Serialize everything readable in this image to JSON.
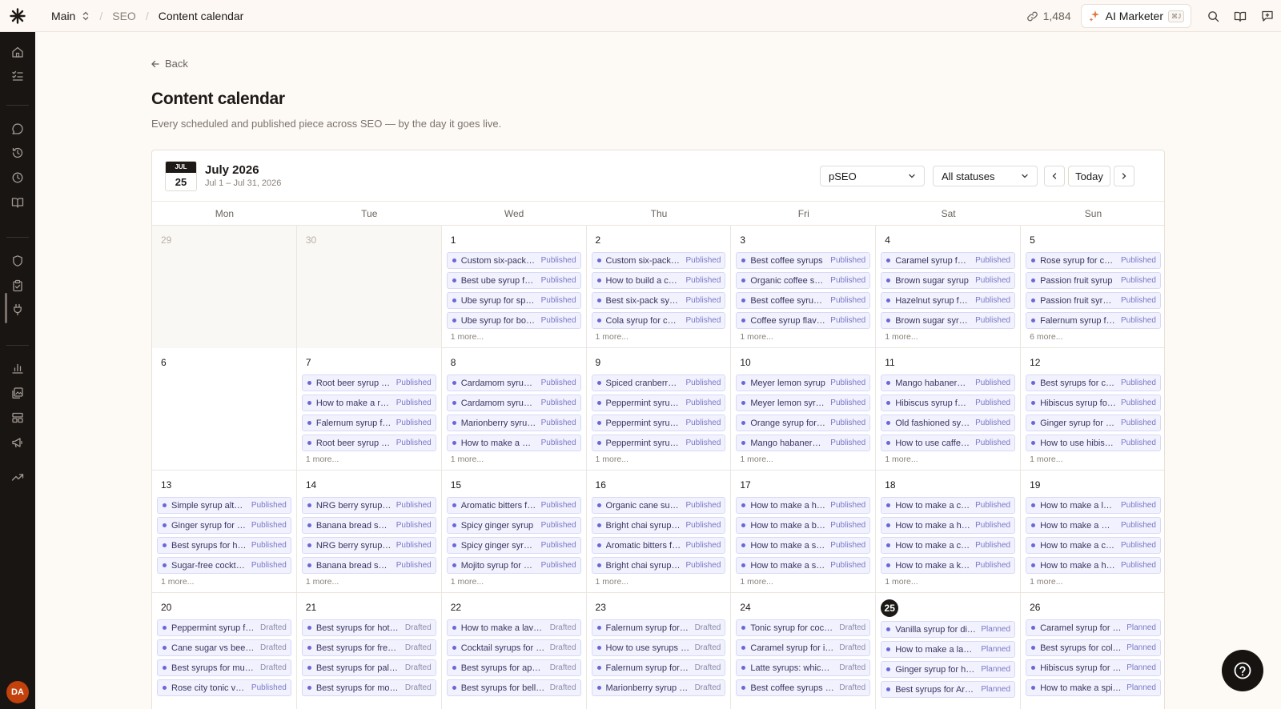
{
  "topbar": {
    "workspace": "Main",
    "section": "SEO",
    "current": "Content calendar",
    "credits": "1,484",
    "ai_label": "AI Marketer",
    "ai_shortcut": "⌘J"
  },
  "sidebar": {
    "avatar_initials": "DA"
  },
  "page": {
    "back": "Back",
    "title": "Content calendar",
    "subtitle": "Every scheduled and published piece across SEO — by the day it goes live."
  },
  "calendar": {
    "badge_month": "JUL",
    "badge_day": "25",
    "title": "July 2026",
    "range": "Jul 1 – Jul 31, 2026",
    "type_filter": "pSEO",
    "status_filter": "All statuses",
    "today_label": "Today",
    "days_of_week": [
      "Mon",
      "Tue",
      "Wed",
      "Thu",
      "Fri",
      "Sat",
      "Sun"
    ],
    "weeks": [
      [
        {
          "num": "29",
          "out": true,
          "events": [],
          "more": ""
        },
        {
          "num": "30",
          "out": true,
          "events": [],
          "more": ""
        },
        {
          "num": "1",
          "events": [
            {
              "title": "Custom six-pack syrup",
              "status": "Published"
            },
            {
              "title": "Best ube syrup for lattes",
              "status": "Published"
            },
            {
              "title": "Ube syrup for sparkling",
              "status": "Published"
            },
            {
              "title": "Ube syrup for boba tea",
              "status": "Published"
            }
          ],
          "more": "1 more..."
        },
        {
          "num": "2",
          "events": [
            {
              "title": "Custom six-pack gift",
              "status": "Published"
            },
            {
              "title": "How to build a coffee bar",
              "status": "Published"
            },
            {
              "title": "Best six-pack syrups",
              "status": "Published"
            },
            {
              "title": "Cola syrup for cocktails",
              "status": "Published"
            }
          ],
          "more": "1 more..."
        },
        {
          "num": "3",
          "events": [
            {
              "title": "Best coffee syrups",
              "status": "Published"
            },
            {
              "title": "Organic coffee syrups",
              "status": "Published"
            },
            {
              "title": "Best coffee syrup sets",
              "status": "Published"
            },
            {
              "title": "Coffee syrup flavors",
              "status": "Published"
            }
          ],
          "more": "1 more..."
        },
        {
          "num": "4",
          "events": [
            {
              "title": "Caramel syrup for lattes",
              "status": "Published"
            },
            {
              "title": "Brown sugar syrup",
              "status": "Published"
            },
            {
              "title": "Hazelnut syrup for mochas",
              "status": "Published"
            },
            {
              "title": "Brown sugar syrup recipes",
              "status": "Published"
            }
          ],
          "more": "1 more..."
        },
        {
          "num": "5",
          "events": [
            {
              "title": "Rose syrup for cocktails",
              "status": "Published"
            },
            {
              "title": "Passion fruit syrup",
              "status": "Published"
            },
            {
              "title": "Passion fruit syrup uses",
              "status": "Published"
            },
            {
              "title": "Falernum syrup for tiki",
              "status": "Published"
            }
          ],
          "more": "6 more..."
        }
      ],
      [
        {
          "num": "6",
          "events": [],
          "more": ""
        },
        {
          "num": "7",
          "events": [
            {
              "title": "Root beer syrup floats",
              "status": "Published"
            },
            {
              "title": "How to make a root beer",
              "status": "Published"
            },
            {
              "title": "Falernum syrup for rum",
              "status": "Published"
            },
            {
              "title": "Root beer syrup recipes",
              "status": "Published"
            }
          ],
          "more": "1 more..."
        },
        {
          "num": "8",
          "events": [
            {
              "title": "Cardamom syrup lattes",
              "status": "Published"
            },
            {
              "title": "Cardamom syrup recipes",
              "status": "Published"
            },
            {
              "title": "Marionberry syrup uses",
              "status": "Published"
            },
            {
              "title": "How to make a mango",
              "status": "Published"
            }
          ],
          "more": "1 more..."
        },
        {
          "num": "9",
          "events": [
            {
              "title": "Spiced cranberry syrup",
              "status": "Published"
            },
            {
              "title": "Peppermint syrup mocha",
              "status": "Published"
            },
            {
              "title": "Peppermint syrup uses",
              "status": "Published"
            },
            {
              "title": "Peppermint syrup recipes",
              "status": "Published"
            }
          ],
          "more": "1 more..."
        },
        {
          "num": "10",
          "events": [
            {
              "title": "Meyer lemon syrup",
              "status": "Published"
            },
            {
              "title": "Meyer lemon syrup uses",
              "status": "Published"
            },
            {
              "title": "Orange syrup for cocktails",
              "status": "Published"
            },
            {
              "title": "Mango habanero syrup",
              "status": "Published"
            }
          ],
          "more": "1 more..."
        },
        {
          "num": "11",
          "events": [
            {
              "title": "Mango habanero syrup",
              "status": "Published"
            },
            {
              "title": "Hibiscus syrup for tea",
              "status": "Published"
            },
            {
              "title": "Old fashioned syrups",
              "status": "Published"
            },
            {
              "title": "How to use caffeine syrup",
              "status": "Published"
            }
          ],
          "more": "1 more..."
        },
        {
          "num": "12",
          "events": [
            {
              "title": "Best syrups for chai",
              "status": "Published"
            },
            {
              "title": "Hibiscus syrup for soda",
              "status": "Published"
            },
            {
              "title": "Ginger syrup for lemonade",
              "status": "Published"
            },
            {
              "title": "How to use hibiscus syrup",
              "status": "Published"
            }
          ],
          "more": "1 more..."
        }
      ],
      [
        {
          "num": "13",
          "events": [
            {
              "title": "Simple syrup alternatives",
              "status": "Published"
            },
            {
              "title": "Ginger syrup for tea",
              "status": "Published"
            },
            {
              "title": "Best syrups for hot cocoa",
              "status": "Published"
            },
            {
              "title": "Sugar-free cocktail syrups",
              "status": "Published"
            }
          ],
          "more": "1 more..."
        },
        {
          "num": "14",
          "events": [
            {
              "title": "NRG berry syrup for soda",
              "status": "Published"
            },
            {
              "title": "Banana bread syrup",
              "status": "Published"
            },
            {
              "title": "NRG berry syrup uses",
              "status": "Published"
            },
            {
              "title": "Banana bread syrup latte",
              "status": "Published"
            }
          ],
          "more": "1 more..."
        },
        {
          "num": "15",
          "events": [
            {
              "title": "Aromatic bitters for drinks",
              "status": "Published"
            },
            {
              "title": "Spicy ginger syrup",
              "status": "Published"
            },
            {
              "title": "Spicy ginger syrup uses",
              "status": "Published"
            },
            {
              "title": "Mojito syrup for cocktails",
              "status": "Published"
            }
          ],
          "more": "1 more..."
        },
        {
          "num": "16",
          "events": [
            {
              "title": "Organic cane sugar syrup",
              "status": "Published"
            },
            {
              "title": "Bright chai syrup for tea",
              "status": "Published"
            },
            {
              "title": "Aromatic bitters for gin",
              "status": "Published"
            },
            {
              "title": "Bright chai syrup latte",
              "status": "Published"
            }
          ],
          "more": "1 more..."
        },
        {
          "num": "17",
          "events": [
            {
              "title": "How to make a hibiscus",
              "status": "Published"
            },
            {
              "title": "How to make a blueberry",
              "status": "Published"
            },
            {
              "title": "How to make a sarsaparilla",
              "status": "Published"
            },
            {
              "title": "How to make a spiced",
              "status": "Published"
            }
          ],
          "more": "1 more..."
        },
        {
          "num": "18",
          "events": [
            {
              "title": "How to make a chai",
              "status": "Published"
            },
            {
              "title": "How to make a hibiscus",
              "status": "Published"
            },
            {
              "title": "How to make a cinnamon",
              "status": "Published"
            },
            {
              "title": "How to make a kid-friendly",
              "status": "Published"
            }
          ],
          "more": "1 more..."
        },
        {
          "num": "19",
          "events": [
            {
              "title": "How to make a lavender",
              "status": "Published"
            },
            {
              "title": "How to make a mango",
              "status": "Published"
            },
            {
              "title": "How to make a classic",
              "status": "Published"
            },
            {
              "title": "How to make a hibiscus",
              "status": "Published"
            }
          ],
          "more": "1 more..."
        }
      ],
      [
        {
          "num": "20",
          "events": [
            {
              "title": "Peppermint syrup for mocha",
              "status": "Drafted"
            },
            {
              "title": "Cane sugar vs beet sugar",
              "status": "Drafted"
            },
            {
              "title": "Best syrups for mulled wine",
              "status": "Drafted"
            },
            {
              "title": "Rose city tonic vs soda",
              "status": "Published"
            }
          ],
          "more": ""
        },
        {
          "num": "21",
          "events": [
            {
              "title": "Best syrups for hot tea",
              "status": "Drafted"
            },
            {
              "title": "Best syrups for french toast",
              "status": "Drafted"
            },
            {
              "title": "Best syrups for palomas",
              "status": "Drafted"
            },
            {
              "title": "Best syrups for mocktails",
              "status": "Drafted"
            }
          ],
          "more": ""
        },
        {
          "num": "22",
          "events": [
            {
              "title": "How to make a lavender",
              "status": "Drafted"
            },
            {
              "title": "Cocktail syrups for parties",
              "status": "Drafted"
            },
            {
              "title": "Best syrups for aperitifs",
              "status": "Drafted"
            },
            {
              "title": "Best syrups for bellinis",
              "status": "Drafted"
            }
          ],
          "more": ""
        },
        {
          "num": "23",
          "events": [
            {
              "title": "Falernum syrup for cocktails",
              "status": "Drafted"
            },
            {
              "title": "How to use syrups in tea",
              "status": "Drafted"
            },
            {
              "title": "Falernum syrup for sours",
              "status": "Drafted"
            },
            {
              "title": "Marionberry syrup for soda",
              "status": "Drafted"
            }
          ],
          "more": ""
        },
        {
          "num": "24",
          "events": [
            {
              "title": "Tonic syrup for cocktails",
              "status": "Drafted"
            },
            {
              "title": "Caramel syrup for iced coffee",
              "status": "Drafted"
            },
            {
              "title": "Latte syrups: which to buy",
              "status": "Drafted"
            },
            {
              "title": "Best coffee syrups for home",
              "status": "Drafted"
            }
          ],
          "more": ""
        },
        {
          "num": "25",
          "today": true,
          "events": [
            {
              "title": "Vanilla syrup for dirty soda",
              "status": "Planned"
            },
            {
              "title": "How to make a lavender",
              "status": "Planned"
            },
            {
              "title": "Ginger syrup for hot toddy",
              "status": "Planned"
            },
            {
              "title": "Best syrups for Arnold Palmer",
              "status": "Planned"
            }
          ],
          "more": ""
        },
        {
          "num": "26",
          "events": [
            {
              "title": "Caramel syrup for hot cocoa",
              "status": "Planned"
            },
            {
              "title": "Best syrups for cold brew",
              "status": "Planned"
            },
            {
              "title": "Hibiscus syrup for iced tea",
              "status": "Planned"
            },
            {
              "title": "How to make a spiced",
              "status": "Planned"
            }
          ],
          "more": ""
        }
      ]
    ]
  }
}
